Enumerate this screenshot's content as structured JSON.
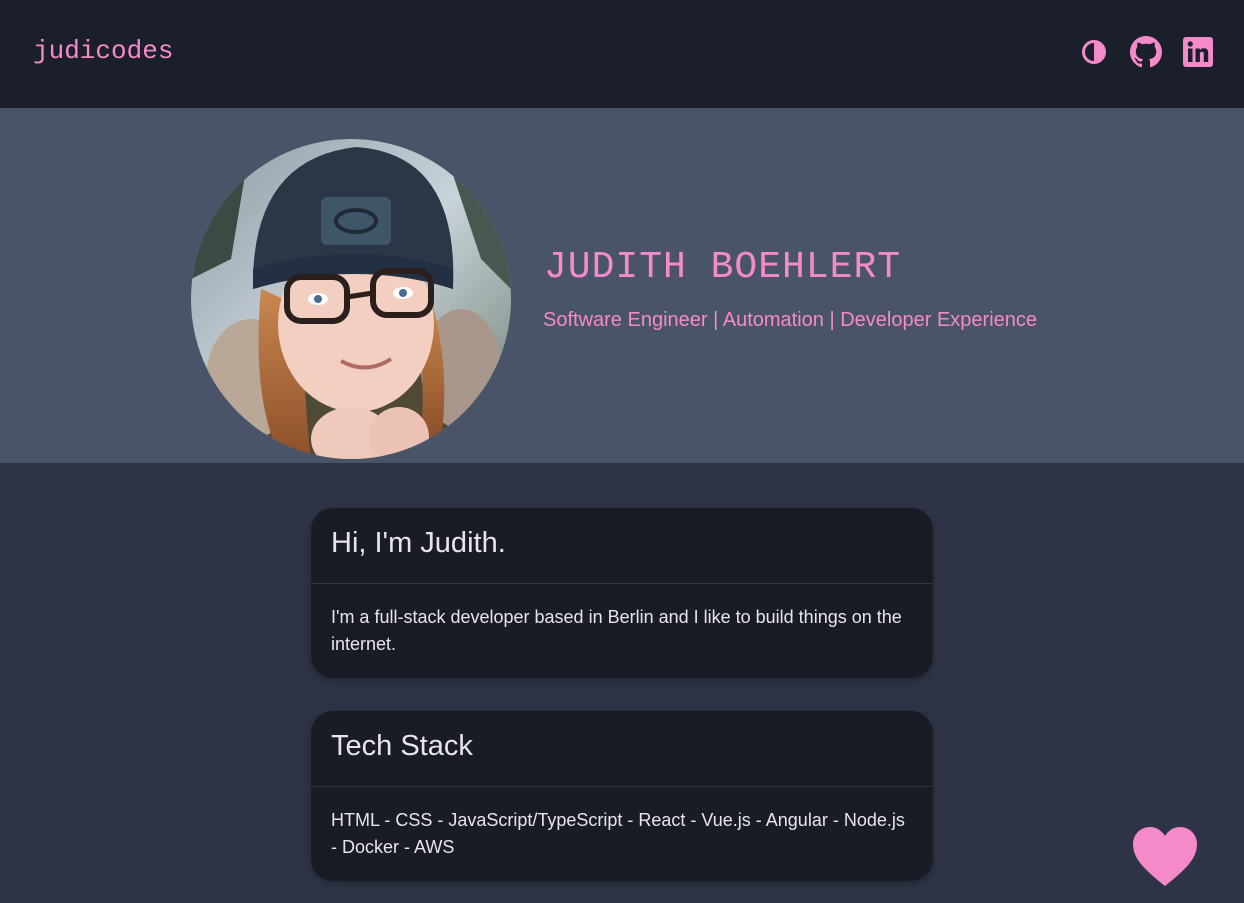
{
  "navbar": {
    "brand": "judicodes",
    "icons": [
      "theme-toggle-icon",
      "github-icon",
      "linkedin-icon"
    ]
  },
  "hero": {
    "name": "JUDITH BOEHLERT",
    "subtitle": "Software Engineer | Automation | Developer Experience",
    "avatar": "profile-photo"
  },
  "cards": [
    {
      "title": "Hi, I'm Judith.",
      "body": "I'm a full-stack developer based in Berlin and I like to build things on the internet."
    },
    {
      "title": "Tech Stack",
      "body": "HTML - CSS - JavaScript/TypeScript - React - Vue.js - Angular - Node.js - Docker - AWS"
    }
  ],
  "floating": {
    "icon": "heart-icon"
  },
  "colors": {
    "accent": "#f58acb",
    "navbar_bg": "#1b1f2c",
    "hero_bg": "#495468",
    "page_bg": "#2e3446",
    "card_bg": "#1a1c25",
    "text": "#e6e6ea"
  }
}
